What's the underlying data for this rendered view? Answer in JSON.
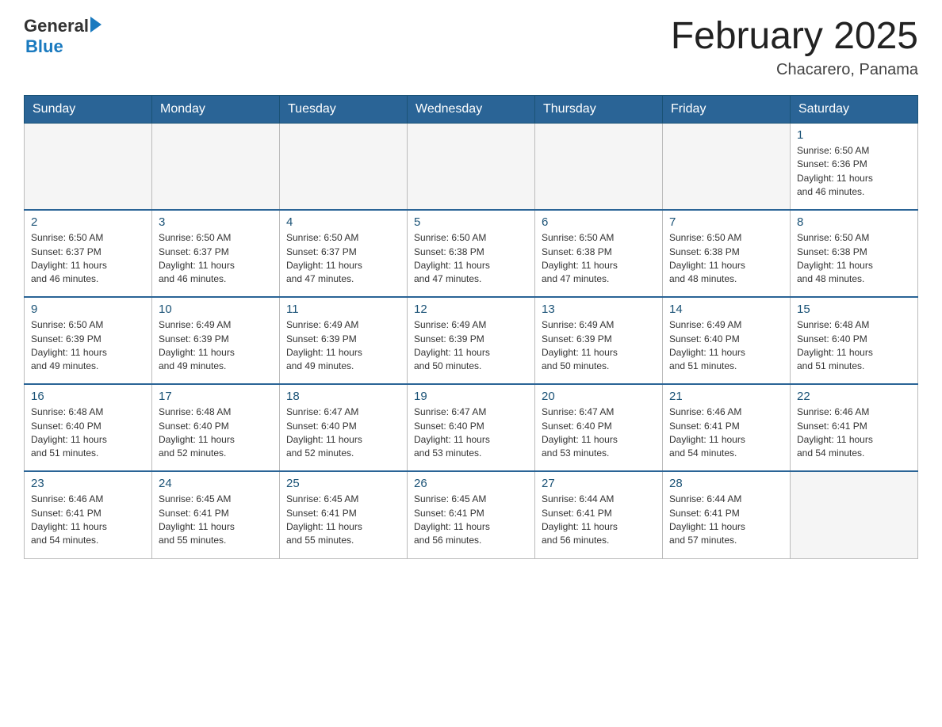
{
  "logo": {
    "general": "General",
    "arrow": "▶",
    "blue": "Blue"
  },
  "title": "February 2025",
  "subtitle": "Chacarero, Panama",
  "days_of_week": [
    "Sunday",
    "Monday",
    "Tuesday",
    "Wednesday",
    "Thursday",
    "Friday",
    "Saturday"
  ],
  "weeks": [
    [
      {
        "day": "",
        "info": ""
      },
      {
        "day": "",
        "info": ""
      },
      {
        "day": "",
        "info": ""
      },
      {
        "day": "",
        "info": ""
      },
      {
        "day": "",
        "info": ""
      },
      {
        "day": "",
        "info": ""
      },
      {
        "day": "1",
        "info": "Sunrise: 6:50 AM\nSunset: 6:36 PM\nDaylight: 11 hours\nand 46 minutes."
      }
    ],
    [
      {
        "day": "2",
        "info": "Sunrise: 6:50 AM\nSunset: 6:37 PM\nDaylight: 11 hours\nand 46 minutes."
      },
      {
        "day": "3",
        "info": "Sunrise: 6:50 AM\nSunset: 6:37 PM\nDaylight: 11 hours\nand 46 minutes."
      },
      {
        "day": "4",
        "info": "Sunrise: 6:50 AM\nSunset: 6:37 PM\nDaylight: 11 hours\nand 47 minutes."
      },
      {
        "day": "5",
        "info": "Sunrise: 6:50 AM\nSunset: 6:38 PM\nDaylight: 11 hours\nand 47 minutes."
      },
      {
        "day": "6",
        "info": "Sunrise: 6:50 AM\nSunset: 6:38 PM\nDaylight: 11 hours\nand 47 minutes."
      },
      {
        "day": "7",
        "info": "Sunrise: 6:50 AM\nSunset: 6:38 PM\nDaylight: 11 hours\nand 48 minutes."
      },
      {
        "day": "8",
        "info": "Sunrise: 6:50 AM\nSunset: 6:38 PM\nDaylight: 11 hours\nand 48 minutes."
      }
    ],
    [
      {
        "day": "9",
        "info": "Sunrise: 6:50 AM\nSunset: 6:39 PM\nDaylight: 11 hours\nand 49 minutes."
      },
      {
        "day": "10",
        "info": "Sunrise: 6:49 AM\nSunset: 6:39 PM\nDaylight: 11 hours\nand 49 minutes."
      },
      {
        "day": "11",
        "info": "Sunrise: 6:49 AM\nSunset: 6:39 PM\nDaylight: 11 hours\nand 49 minutes."
      },
      {
        "day": "12",
        "info": "Sunrise: 6:49 AM\nSunset: 6:39 PM\nDaylight: 11 hours\nand 50 minutes."
      },
      {
        "day": "13",
        "info": "Sunrise: 6:49 AM\nSunset: 6:39 PM\nDaylight: 11 hours\nand 50 minutes."
      },
      {
        "day": "14",
        "info": "Sunrise: 6:49 AM\nSunset: 6:40 PM\nDaylight: 11 hours\nand 51 minutes."
      },
      {
        "day": "15",
        "info": "Sunrise: 6:48 AM\nSunset: 6:40 PM\nDaylight: 11 hours\nand 51 minutes."
      }
    ],
    [
      {
        "day": "16",
        "info": "Sunrise: 6:48 AM\nSunset: 6:40 PM\nDaylight: 11 hours\nand 51 minutes."
      },
      {
        "day": "17",
        "info": "Sunrise: 6:48 AM\nSunset: 6:40 PM\nDaylight: 11 hours\nand 52 minutes."
      },
      {
        "day": "18",
        "info": "Sunrise: 6:47 AM\nSunset: 6:40 PM\nDaylight: 11 hours\nand 52 minutes."
      },
      {
        "day": "19",
        "info": "Sunrise: 6:47 AM\nSunset: 6:40 PM\nDaylight: 11 hours\nand 53 minutes."
      },
      {
        "day": "20",
        "info": "Sunrise: 6:47 AM\nSunset: 6:40 PM\nDaylight: 11 hours\nand 53 minutes."
      },
      {
        "day": "21",
        "info": "Sunrise: 6:46 AM\nSunset: 6:41 PM\nDaylight: 11 hours\nand 54 minutes."
      },
      {
        "day": "22",
        "info": "Sunrise: 6:46 AM\nSunset: 6:41 PM\nDaylight: 11 hours\nand 54 minutes."
      }
    ],
    [
      {
        "day": "23",
        "info": "Sunrise: 6:46 AM\nSunset: 6:41 PM\nDaylight: 11 hours\nand 54 minutes."
      },
      {
        "day": "24",
        "info": "Sunrise: 6:45 AM\nSunset: 6:41 PM\nDaylight: 11 hours\nand 55 minutes."
      },
      {
        "day": "25",
        "info": "Sunrise: 6:45 AM\nSunset: 6:41 PM\nDaylight: 11 hours\nand 55 minutes."
      },
      {
        "day": "26",
        "info": "Sunrise: 6:45 AM\nSunset: 6:41 PM\nDaylight: 11 hours\nand 56 minutes."
      },
      {
        "day": "27",
        "info": "Sunrise: 6:44 AM\nSunset: 6:41 PM\nDaylight: 11 hours\nand 56 minutes."
      },
      {
        "day": "28",
        "info": "Sunrise: 6:44 AM\nSunset: 6:41 PM\nDaylight: 11 hours\nand 57 minutes."
      },
      {
        "day": "",
        "info": ""
      }
    ]
  ]
}
